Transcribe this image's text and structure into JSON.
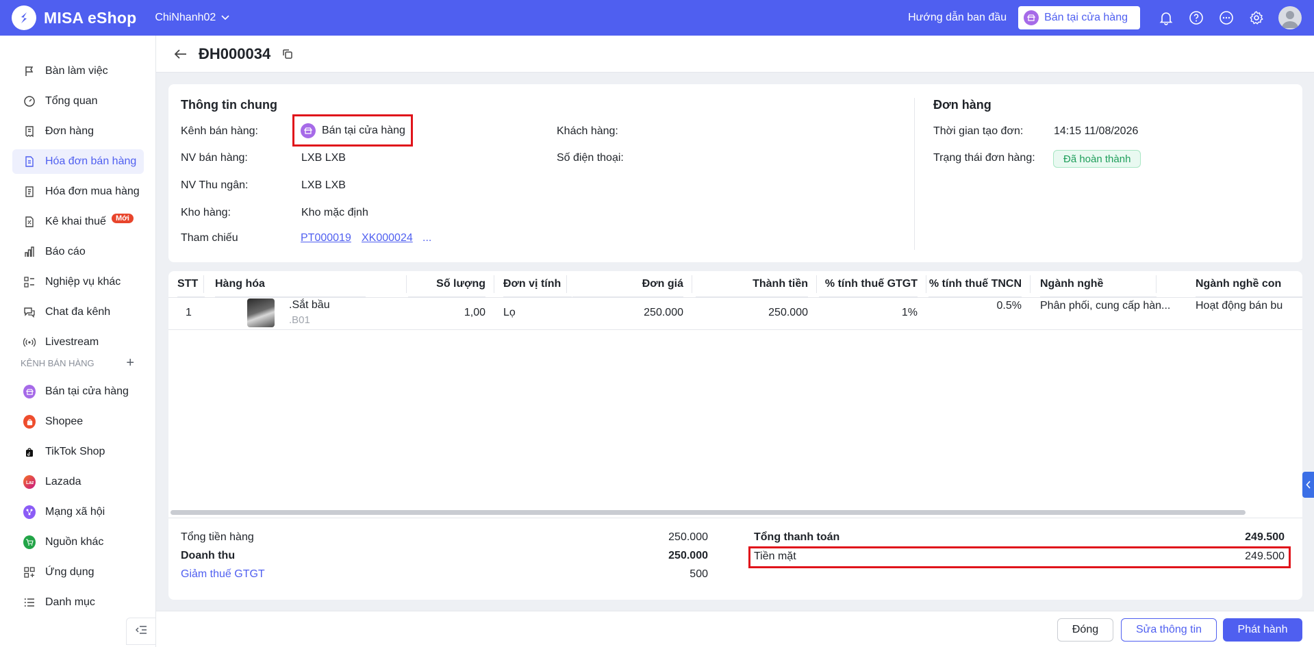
{
  "app": {
    "name": "MISA eShop",
    "branch": "ChiNhanh02",
    "guide_link": "Hướng dẫn ban đầu",
    "store_button": "Bán tại cửa hàng",
    "brand_color": "#4f5ff0"
  },
  "sidebar": {
    "items": [
      {
        "label": "Bàn làm việc",
        "icon": "flag-icon"
      },
      {
        "label": "Tổng quan",
        "icon": "gauge-icon"
      },
      {
        "label": "Đơn hàng",
        "icon": "receipt-icon"
      },
      {
        "label": "Hóa đơn bán hàng",
        "icon": "invoice-icon",
        "active": true
      },
      {
        "label": "Hóa đơn mua hàng",
        "icon": "purchase-invoice-icon"
      },
      {
        "label": "Kê khai thuế",
        "icon": "tax-form-icon",
        "badge": "Mới"
      },
      {
        "label": "Báo cáo",
        "icon": "bar-chart-icon"
      },
      {
        "label": "Nghiệp vụ khác",
        "icon": "list-grid-icon"
      },
      {
        "label": "Chat đa kênh",
        "icon": "chat-icon"
      },
      {
        "label": "Livestream",
        "icon": "broadcast-icon"
      }
    ],
    "section_title": "KÊNH BÁN HÀNG",
    "channels": [
      {
        "label": "Bán tại cửa hàng",
        "icon": "store-icon",
        "color": "#a66ae8"
      },
      {
        "label": "Shopee",
        "icon": "shopee-icon",
        "color": "#ee4d2d"
      },
      {
        "label": "TikTok Shop",
        "icon": "tiktok-icon",
        "color": "#111111"
      },
      {
        "label": "Lazada",
        "icon": "lazada-icon",
        "color": "#f57224"
      },
      {
        "label": "Mạng xã hội",
        "icon": "social-network-icon",
        "color": "#8b5cf6"
      },
      {
        "label": "Nguồn khác",
        "icon": "cart-icon",
        "color": "#22a447"
      },
      {
        "label": "Ứng dụng",
        "icon": "apps-icon",
        "color": ""
      },
      {
        "label": "Danh mục",
        "icon": "list-icon",
        "color": ""
      }
    ]
  },
  "header": {
    "title": "ĐH000034"
  },
  "general": {
    "title": "Thông tin chung",
    "channel_label": "Kênh bán hàng:",
    "channel_value": "Bán tại cửa hàng",
    "seller_label": "NV bán hàng:",
    "seller_value": "LXB LXB",
    "cashier_label": "NV Thu ngân:",
    "cashier_value": "LXB LXB",
    "warehouse_label": "Kho hàng:",
    "warehouse_value": "Kho mặc định",
    "reference_label": "Tham chiếu",
    "reference_1": "PT000019",
    "reference_2": "XK000024",
    "reference_more": "...",
    "customer_label": "Khách hàng:",
    "phone_label": "Số điện thoại:"
  },
  "order": {
    "title": "Đơn hàng",
    "created_label": "Thời gian tạo đơn:",
    "created_value": "14:15 11/08/2026",
    "status_label": "Trạng thái đơn hàng:",
    "status_value": "Đã hoàn thành"
  },
  "table": {
    "columns": [
      "STT",
      "Hàng hóa",
      "Số lượng",
      "Đơn vị tính",
      "Đơn giá",
      "Thành tiền",
      "% tính thuế GTGT",
      "% tính thuế TNCN",
      "Ngành nghề",
      "Ngành nghề con"
    ],
    "rows": [
      {
        "stt": "1",
        "name": ".Sắt bầu",
        "code": ".B01",
        "qty": "1,00",
        "unit": "Lọ",
        "price": "250.000",
        "amount": "250.000",
        "vat": "1%",
        "pit": "0.5%",
        "industry": "Phân phối, cung cấp hàn...",
        "sub_industry": "Hoạt động bán bu"
      }
    ]
  },
  "summary": {
    "left": [
      {
        "label": "Tổng tiền hàng",
        "value": "250.000"
      },
      {
        "label": "Doanh thu",
        "value": "250.000"
      },
      {
        "label": "Giảm thuế GTGT",
        "value": "500"
      }
    ],
    "total_label": "Tổng thanh toán",
    "total_value": "249.500",
    "cash_label": "Tiền mặt",
    "cash_value": "249.500"
  },
  "footer": {
    "close": "Đóng",
    "edit": "Sửa thông tin",
    "publish": "Phát hành"
  }
}
